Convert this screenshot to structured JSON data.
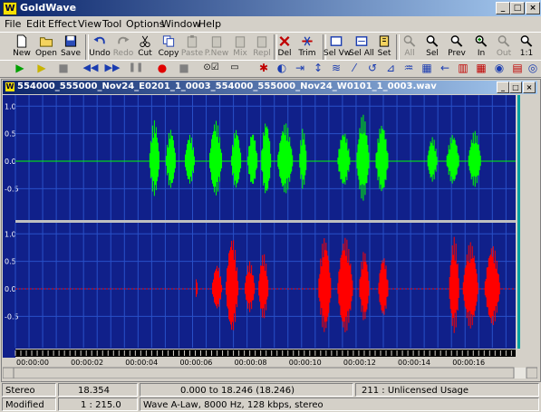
{
  "app": {
    "title": "GoldWave",
    "logo": "W"
  },
  "menu": [
    "File",
    "Edit",
    "Effect",
    "View",
    "Tool",
    "Options",
    "Window",
    "Help"
  ],
  "toolbar": [
    {
      "label": "New",
      "icon": "new-file-icon",
      "enabled": true
    },
    {
      "label": "Open",
      "icon": "open-folder-icon",
      "enabled": true
    },
    {
      "label": "Save",
      "icon": "save-icon",
      "enabled": true
    },
    {
      "label": "Undo",
      "icon": "undo-icon",
      "enabled": true
    },
    {
      "label": "Redo",
      "icon": "redo-icon",
      "enabled": false
    },
    {
      "label": "Cut",
      "icon": "cut-icon",
      "enabled": true
    },
    {
      "label": "Copy",
      "icon": "copy-icon",
      "enabled": true
    },
    {
      "label": "Paste",
      "icon": "paste-icon",
      "enabled": false
    },
    {
      "label": "P.New",
      "icon": "paste-new-icon",
      "enabled": false
    },
    {
      "label": "Mix",
      "icon": "mix-icon",
      "enabled": false
    },
    {
      "label": "Repl",
      "icon": "replace-icon",
      "enabled": false
    },
    {
      "label": "Del",
      "icon": "delete-icon",
      "enabled": true
    },
    {
      "label": "Trim",
      "icon": "trim-icon",
      "enabled": true
    },
    {
      "label": "Sel Vw",
      "icon": "select-view-icon",
      "enabled": true
    },
    {
      "label": "Sel All",
      "icon": "select-all-icon",
      "enabled": true
    },
    {
      "label": "Set",
      "icon": "set-marker-icon",
      "enabled": true
    },
    {
      "label": "All",
      "icon": "zoom-all-icon",
      "enabled": false
    },
    {
      "label": "Sel",
      "icon": "zoom-selection-icon",
      "enabled": true
    },
    {
      "label": "Prev",
      "icon": "zoom-previous-icon",
      "enabled": true
    },
    {
      "label": "In",
      "icon": "zoom-in-icon",
      "enabled": true
    },
    {
      "label": "Out",
      "icon": "zoom-out-icon",
      "enabled": false
    },
    {
      "label": "1:1",
      "icon": "zoom-1to1-icon",
      "enabled": true
    }
  ],
  "transport": [
    "play-icon",
    "play-selection-icon",
    "stop-icon",
    "rewind-icon",
    "fast-forward-icon",
    "pause-icon",
    "record-icon",
    "stop-record-icon",
    "device-controls-icon",
    "loop-icon"
  ],
  "effects_bar": [
    "effect-1-icon",
    "effect-2-icon",
    "effect-3-icon",
    "effect-4-icon",
    "effect-5-icon",
    "effect-6-icon",
    "effect-7-icon",
    "effect-8-icon",
    "effect-9-icon",
    "effect-10-icon",
    "effect-11-icon",
    "effect-12-icon",
    "effect-13-icon",
    "effect-14-icon",
    "effect-15-icon",
    "effect-16-icon"
  ],
  "document": {
    "title": "554000_555000_Nov24_E0201_1_0003_554000_555000_Nov24_W0101_1_0003.wav"
  },
  "waveform": {
    "bg_color": "#10208a",
    "grid_color": "#2850c8",
    "left_color": "#00ff00",
    "right_color": "#ff0000",
    "y_ticks": [
      "1.0",
      "0.5",
      "0.0",
      "-0.5"
    ],
    "x_ticks": [
      "00:00:00",
      "00:00:02",
      "00:00:04",
      "00:00:06",
      "00:00:08",
      "00:00:10",
      "00:00:12",
      "00:00:14",
      "00:00:16"
    ],
    "duration_seconds": 18.354,
    "left_bursts": [
      [
        4.9,
        5.3,
        0.75
      ],
      [
        5.5,
        5.9,
        0.6
      ],
      [
        6.2,
        6.6,
        0.5
      ],
      [
        7.1,
        7.6,
        0.75
      ],
      [
        7.9,
        8.3,
        0.6
      ],
      [
        8.5,
        8.9,
        0.55
      ],
      [
        9.0,
        9.4,
        0.75
      ],
      [
        9.6,
        10.2,
        0.7
      ],
      [
        10.4,
        10.7,
        0.6
      ],
      [
        11.8,
        12.3,
        0.55
      ],
      [
        12.5,
        13.0,
        0.85
      ],
      [
        13.2,
        13.7,
        0.7
      ],
      [
        15.1,
        15.5,
        0.45
      ],
      [
        15.8,
        16.3,
        0.5
      ],
      [
        16.6,
        17.1,
        0.55
      ]
    ],
    "right_bursts": [
      [
        6.6,
        6.7,
        0.2
      ],
      [
        7.2,
        7.6,
        0.45
      ],
      [
        7.7,
        8.2,
        0.95
      ],
      [
        8.4,
        8.8,
        0.5
      ],
      [
        8.9,
        9.3,
        0.65
      ],
      [
        11.1,
        11.6,
        0.95
      ],
      [
        11.8,
        12.4,
        0.95
      ],
      [
        12.6,
        13.0,
        0.7
      ],
      [
        13.3,
        13.7,
        0.6
      ],
      [
        15.9,
        16.3,
        0.95
      ],
      [
        16.4,
        17.0,
        0.85
      ],
      [
        17.2,
        17.8,
        0.8
      ]
    ]
  },
  "status": {
    "channel": "Stereo",
    "duration": "18.354",
    "selection": "0.000 to 18.246 (18.246)",
    "license": "211 : Unlicensed Usage",
    "state": "Modified",
    "zoom": "1 : 215.0",
    "format": "Wave A-Law, 8000 Hz, 128 kbps, stereo"
  }
}
